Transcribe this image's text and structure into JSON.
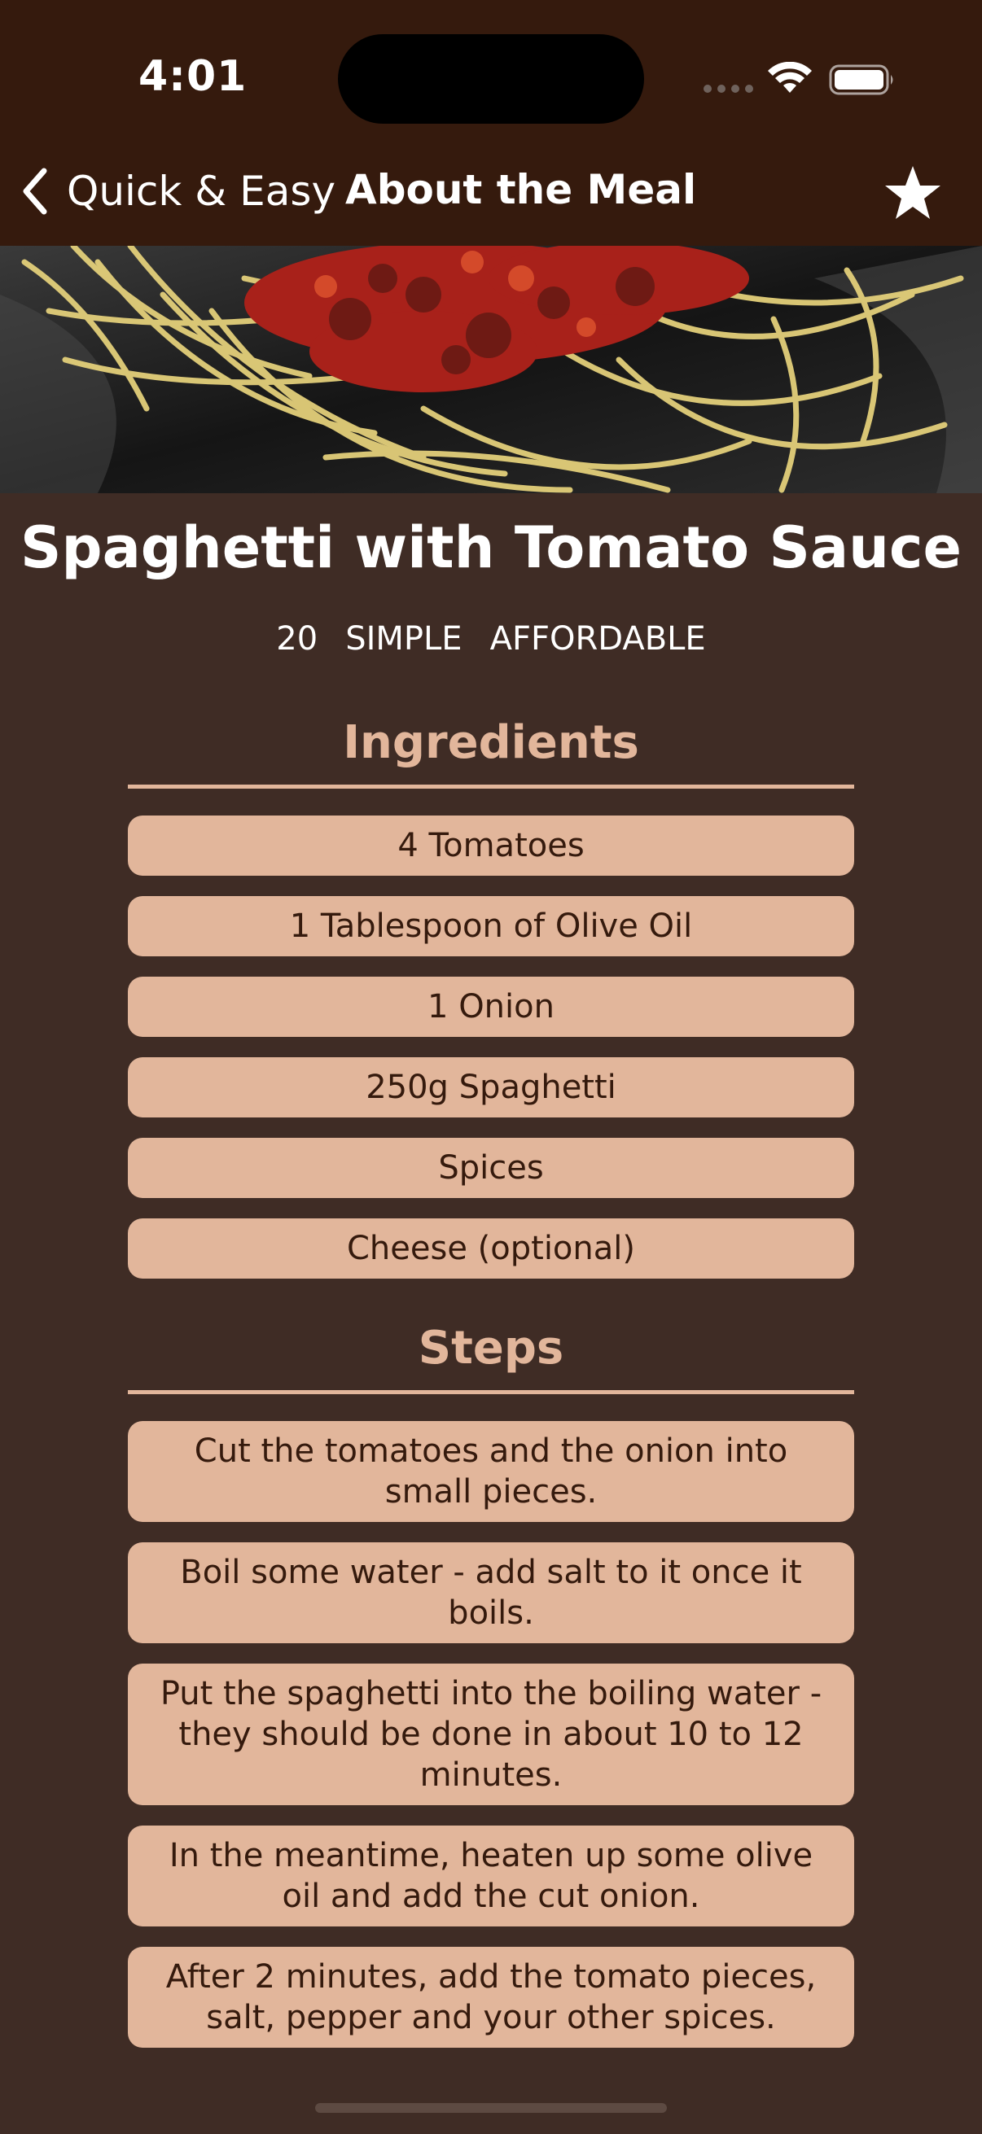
{
  "status_bar": {
    "time": "4:01",
    "wifi_icon": "wifi-icon",
    "battery_icon": "battery-icon"
  },
  "nav": {
    "back_label": "Quick & Easy",
    "back_icon": "chevron-left-icon",
    "title": "About the Meal",
    "favorite_icon": "star-icon"
  },
  "meal": {
    "title": "Spaghetti with Tomato Sauce",
    "duration": "20",
    "complexity": "SIMPLE",
    "affordability": "AFFORDABLE"
  },
  "ingredients": {
    "heading": "Ingredients",
    "items": [
      "4 Tomatoes",
      "1 Tablespoon of Olive Oil",
      "1 Onion",
      "250g Spaghetti",
      "Spices",
      "Cheese (optional)"
    ]
  },
  "steps": {
    "heading": "Steps",
    "items": [
      "Cut the tomatoes and the onion into small pieces.",
      "Boil some water - add salt to it once it boils.",
      "Put the spaghetti into the boiling water - they should be done in about 10 to 12 minutes.",
      "In the meantime, heaten up some olive oil and add the cut onion.",
      "After 2 minutes, add the tomato pieces, salt, pepper and your other spices."
    ]
  },
  "colors": {
    "header_bg": "#351a0d",
    "screen_bg": "#3f2c25",
    "accent": "#e2b69b",
    "pill_text": "#351a0d"
  }
}
